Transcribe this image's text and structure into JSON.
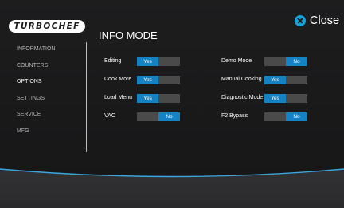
{
  "logo": {
    "text": "TURBOCHEF"
  },
  "title": "INFO MODE",
  "close_label": "Close",
  "menu": [
    "INFORMATION",
    "COUNTERS",
    "OPTIONS",
    "SETTINGS",
    "SERVICE",
    "MFG"
  ],
  "active_menu": "OPTIONS",
  "options_left": [
    {
      "label": "Editing",
      "value": "Yes"
    },
    {
      "label": "Cook More",
      "value": "Yes"
    },
    {
      "label": "Load Menu",
      "value": "Yes"
    },
    {
      "label": "VAC",
      "value": "No"
    }
  ],
  "options_right": [
    {
      "label": "Demo Mode",
      "value": "No"
    },
    {
      "label": "Manual Cooking",
      "value": "Yes"
    },
    {
      "label": "Diagnostic Mode",
      "value": "Yes"
    },
    {
      "label": "F2 Bypass",
      "value": "No"
    }
  ],
  "colors": {
    "accent": "#1582c3",
    "close": "#18a1da",
    "inactive": "#4a4a4a",
    "background": "#1b1b1c",
    "bottom_band": "#2e2e30",
    "band_line": "#3aa5de"
  },
  "icons": {
    "close": "close-icon"
  }
}
